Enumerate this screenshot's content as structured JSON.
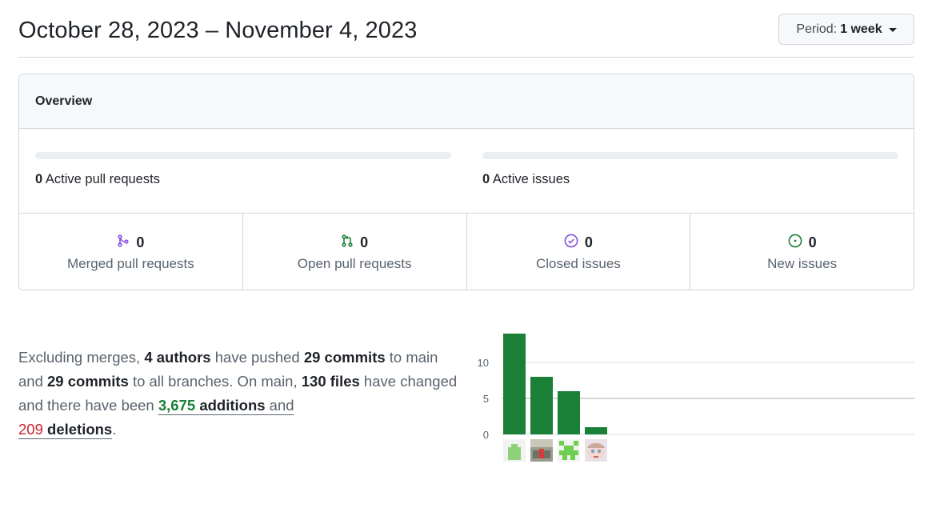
{
  "header": {
    "title": "October 28, 2023 – November 4, 2023",
    "period_label": "Period:",
    "period_value": "1 week"
  },
  "overview": {
    "title": "Overview",
    "active_pull_requests": {
      "count": "0",
      "label": "Active pull requests",
      "progress": 0
    },
    "active_issues": {
      "count": "0",
      "label": "Active issues",
      "progress": 0
    },
    "stats": [
      {
        "icon": "git-merge-icon",
        "count": "0",
        "label": "Merged pull requests",
        "color": "#8250df"
      },
      {
        "icon": "git-pull-request-icon",
        "count": "0",
        "label": "Open pull requests",
        "color": "#1a7f37"
      },
      {
        "icon": "issue-closed-icon",
        "count": "0",
        "label": "Closed issues",
        "color": "#8250df"
      },
      {
        "icon": "issue-opened-icon",
        "count": "0",
        "label": "New issues",
        "color": "#1a7f37"
      }
    ]
  },
  "summary": {
    "t1": "Excluding merges, ",
    "authors": "4 authors",
    "t2": " have pushed ",
    "commits_main": "29 commits",
    "t3": " to main and ",
    "commits_all": "29 commits",
    "t4": " to all branches. On main, ",
    "files": "130 files",
    "t5": " have changed and there have been ",
    "additions_num": "3,675",
    "additions_word": "additions",
    "t6": " and",
    "deletions_num": "209",
    "deletions_word": "deletions",
    "t7": "."
  },
  "chart_data": {
    "type": "bar",
    "categories": [
      "author-1",
      "author-2",
      "author-3",
      "author-4"
    ],
    "values": [
      14,
      8,
      6,
      1
    ],
    "ylim": [
      0,
      14
    ],
    "yticks": [
      0,
      5,
      10
    ],
    "bar_color": "#1a7f37",
    "grid": true
  }
}
